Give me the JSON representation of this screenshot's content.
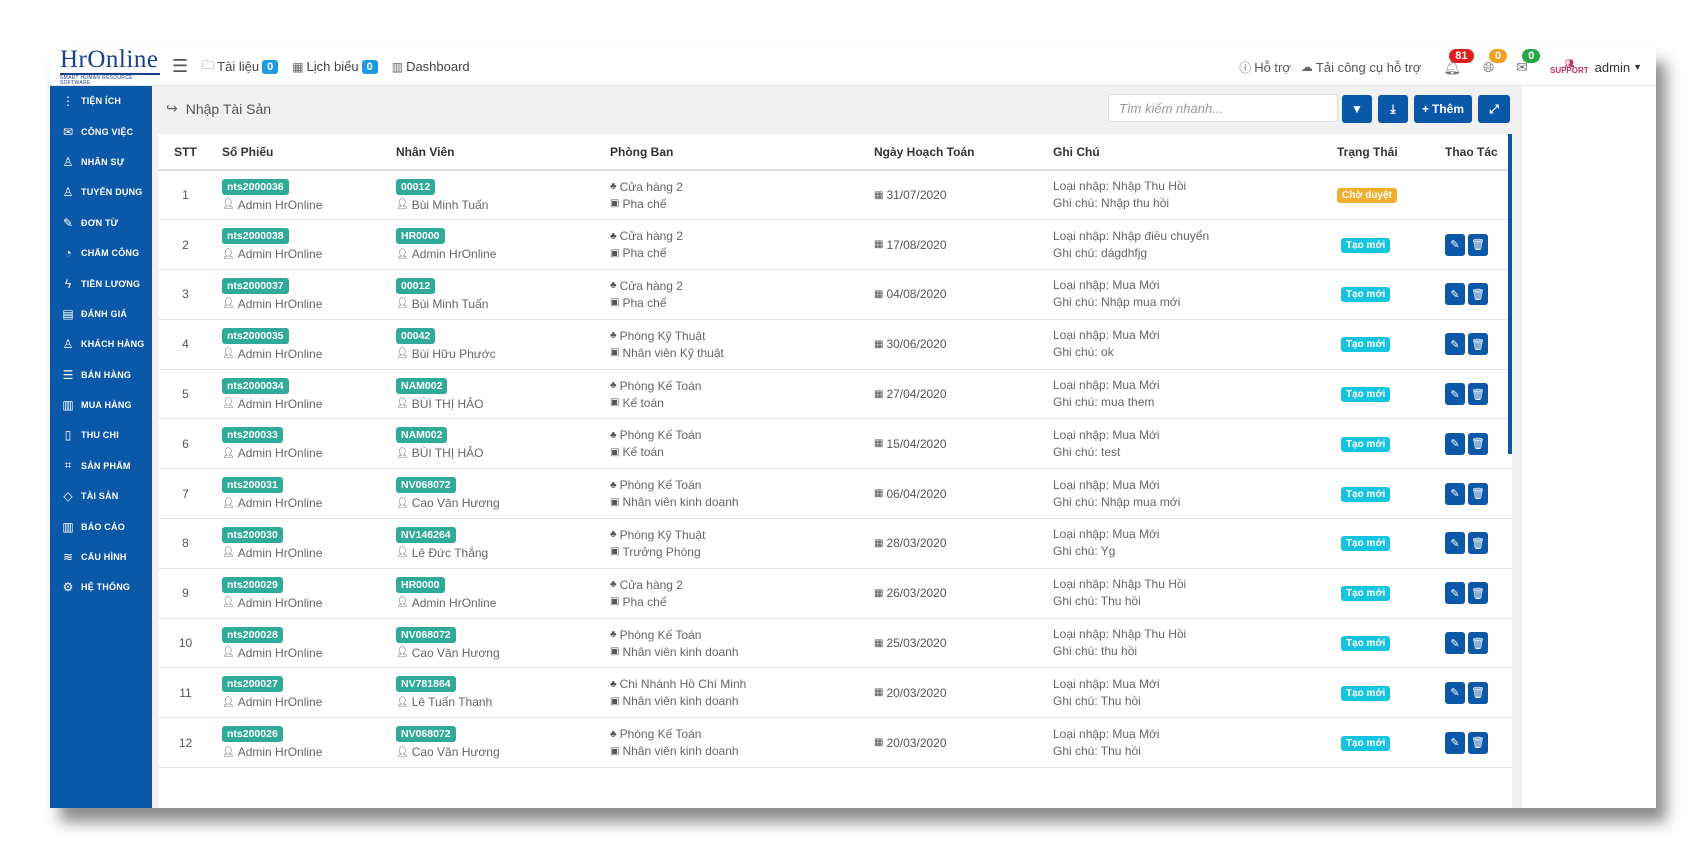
{
  "brand": {
    "name": "HrOnline",
    "tagline": "SMART HUMAN RESOURCE SOFTWARE"
  },
  "topnav": {
    "links": [
      {
        "label": "Tài liệu",
        "count": "0"
      },
      {
        "label": "Lịch biểu",
        "count": "0"
      },
      {
        "label": "Dashboard"
      }
    ],
    "support": "Hỗ trợ",
    "download": "Tải công cụ hỗ trợ",
    "notifications": "81",
    "globe": "0",
    "messages": "0",
    "support_logo": "SUPPORT",
    "user": "admin"
  },
  "sidebar": {
    "items": [
      {
        "label": "TIỆN ÍCH",
        "icon": "vertical-dots-icon"
      },
      {
        "label": "CÔNG VIỆC",
        "icon": "inbox-icon"
      },
      {
        "label": "NHÂN SỰ",
        "icon": "user-icon"
      },
      {
        "label": "TUYỂN DỤNG",
        "icon": "user-add-icon"
      },
      {
        "label": "ĐƠN TỪ",
        "icon": "edit-icon"
      },
      {
        "label": "CHẤM CÔNG",
        "icon": "gauge-icon"
      },
      {
        "label": "TIỀN LƯƠNG",
        "icon": "bolt-icon"
      },
      {
        "label": "ĐÁNH GIÁ",
        "icon": "book-icon"
      },
      {
        "label": "KHÁCH HÀNG",
        "icon": "customer-icon"
      },
      {
        "label": "BÁN HÀNG",
        "icon": "list-icon"
      },
      {
        "label": "MUA HÀNG",
        "icon": "map-icon"
      },
      {
        "label": "THU CHI",
        "icon": "file-icon"
      },
      {
        "label": "SẢN PHẨM",
        "icon": "tag-icon"
      },
      {
        "label": "TÀI SẢN",
        "icon": "diamond-icon"
      },
      {
        "label": "BÁO CÁO",
        "icon": "bar-chart-icon"
      },
      {
        "label": "CẤU HÌNH",
        "icon": "layers-icon"
      },
      {
        "label": "HỆ THỐNG",
        "icon": "gear-icon"
      }
    ]
  },
  "page": {
    "title": "Nhập Tài Sản",
    "search_placeholder": "Tìm kiếm nhanh...",
    "add_label": "Thêm"
  },
  "colors": {
    "primary": "#0b57a8",
    "badge_teal": "#30aa99",
    "status_cyan": "#17c4e0",
    "status_orange": "#f0ad2e"
  },
  "table": {
    "headers": {
      "stt": "STT",
      "ticket": "Số Phiếu",
      "employee": "Nhân Viên",
      "department": "Phòng Ban",
      "date": "Ngày Hoạch Toán",
      "note": "Ghi Chú",
      "status": "Trạng Thái",
      "actions": "Thao Tác"
    },
    "rows": [
      {
        "stt": "1",
        "ticket": "nts2000036",
        "creator": "Admin HrOnline",
        "emp_code": "00012",
        "emp_name": "Bùi Minh Tuấn",
        "dept": "Cửa hàng 2",
        "position": "Pha chế",
        "date": "31/07/2020",
        "type": "Loại nhập: Nhập Thu Hồi",
        "note": "Ghi chú: Nhập thu hồi",
        "status": "Chờ duyệt",
        "status_color": "orange",
        "has_actions": false
      },
      {
        "stt": "2",
        "ticket": "nts2000038",
        "creator": "Admin HrOnline",
        "emp_code": "HR0000",
        "emp_name": "Admin HrOnline",
        "dept": "Cửa hàng 2",
        "position": "Pha chế",
        "date": "17/08/2020",
        "type": "Loại nhập: Nhập điều chuyển",
        "note": "Ghi chú: dágdhfjg",
        "status": "Tạo mới",
        "status_color": "cyan",
        "has_actions": true
      },
      {
        "stt": "3",
        "ticket": "nts2000037",
        "creator": "Admin HrOnline",
        "emp_code": "00012",
        "emp_name": "Bùi Minh Tuấn",
        "dept": "Cửa hàng 2",
        "position": "Pha chế",
        "date": "04/08/2020",
        "type": "Loại nhập: Mua Mới",
        "note": "Ghi chú: Nhập mua mới",
        "status": "Tạo mới",
        "status_color": "cyan",
        "has_actions": true
      },
      {
        "stt": "4",
        "ticket": "nts2000035",
        "creator": "Admin HrOnline",
        "emp_code": "00042",
        "emp_name": "Bùi Hữu Phước",
        "dept": "Phòng Kỹ Thuật",
        "position": "Nhân viên Kỹ thuật",
        "date": "30/06/2020",
        "type": "Loại nhập: Mua Mới",
        "note": "Ghi chú: ok",
        "status": "Tạo mới",
        "status_color": "cyan",
        "has_actions": true
      },
      {
        "stt": "5",
        "ticket": "nts2000034",
        "creator": "Admin HrOnline",
        "emp_code": "NAM002",
        "emp_name": "BÙI THỊ HẢO",
        "dept": "Phòng Kế Toán",
        "position": "Kế toán",
        "date": "27/04/2020",
        "type": "Loại nhập: Mua Mới",
        "note": "Ghi chú: mua them",
        "status": "Tạo mới",
        "status_color": "cyan",
        "has_actions": true
      },
      {
        "stt": "6",
        "ticket": "nts200033",
        "creator": "Admin HrOnline",
        "emp_code": "NAM002",
        "emp_name": "BÙI THỊ HẢO",
        "dept": "Phòng Kế Toán",
        "position": "Kế toán",
        "date": "15/04/2020",
        "type": "Loại nhập: Mua Mới",
        "note": "Ghi chú: test",
        "status": "Tạo mới",
        "status_color": "cyan",
        "has_actions": true
      },
      {
        "stt": "7",
        "ticket": "nts200031",
        "creator": "Admin HrOnline",
        "emp_code": "NV068072",
        "emp_name": "Cao Văn Hương",
        "dept": "Phòng Kế Toán",
        "position": "Nhân viên kinh doanh",
        "date": "06/04/2020",
        "type": "Loại nhập: Mua Mới",
        "note": "Ghi chú: Nhập mua mới",
        "status": "Tạo mới",
        "status_color": "cyan",
        "has_actions": true
      },
      {
        "stt": "8",
        "ticket": "nts200030",
        "creator": "Admin HrOnline",
        "emp_code": "NV146264",
        "emp_name": "Lê Đức Thắng",
        "dept": "Phòng Kỹ Thuật",
        "position": "Trưởng Phòng",
        "date": "28/03/2020",
        "type": "Loại nhập: Mua Mới",
        "note": "Ghi chú: Yg",
        "status": "Tạo mới",
        "status_color": "cyan",
        "has_actions": true
      },
      {
        "stt": "9",
        "ticket": "nts200029",
        "creator": "Admin HrOnline",
        "emp_code": "HR0000",
        "emp_name": "Admin HrOnline",
        "dept": "Cửa hàng 2",
        "position": "Pha chế",
        "date": "26/03/2020",
        "type": "Loại nhập: Nhập Thu Hồi",
        "note": "Ghi chú: Thu hồi",
        "status": "Tạo mới",
        "status_color": "cyan",
        "has_actions": true
      },
      {
        "stt": "10",
        "ticket": "nts200028",
        "creator": "Admin HrOnline",
        "emp_code": "NV068072",
        "emp_name": "Cao Văn Hương",
        "dept": "Phòng Kế Toán",
        "position": "Nhân viên kinh doanh",
        "date": "25/03/2020",
        "type": "Loại nhập: Nhập Thu Hồi",
        "note": "Ghi chú: thu hồi",
        "status": "Tạo mới",
        "status_color": "cyan",
        "has_actions": true
      },
      {
        "stt": "11",
        "ticket": "nts200027",
        "creator": "Admin HrOnline",
        "emp_code": "NV781864",
        "emp_name": "Lê Tuấn Thanh",
        "dept": "Chi Nhánh Hồ Chí Minh",
        "position": "Nhân viên kinh doanh",
        "date": "20/03/2020",
        "type": "Loại nhập: Mua Mới",
        "note": "Ghi chú: Thu hồi",
        "status": "Tạo mới",
        "status_color": "cyan",
        "has_actions": true
      },
      {
        "stt": "12",
        "ticket": "nts200026",
        "creator": "Admin HrOnline",
        "emp_code": "NV068072",
        "emp_name": "Cao Văn Hương",
        "dept": "Phòng Kế Toán",
        "position": "Nhân viên kinh doanh",
        "date": "20/03/2020",
        "type": "Loại nhập: Mua Mới",
        "note": "Ghi chú: Thu hồi",
        "status": "Tạo mới",
        "status_color": "cyan",
        "has_actions": true
      }
    ]
  }
}
